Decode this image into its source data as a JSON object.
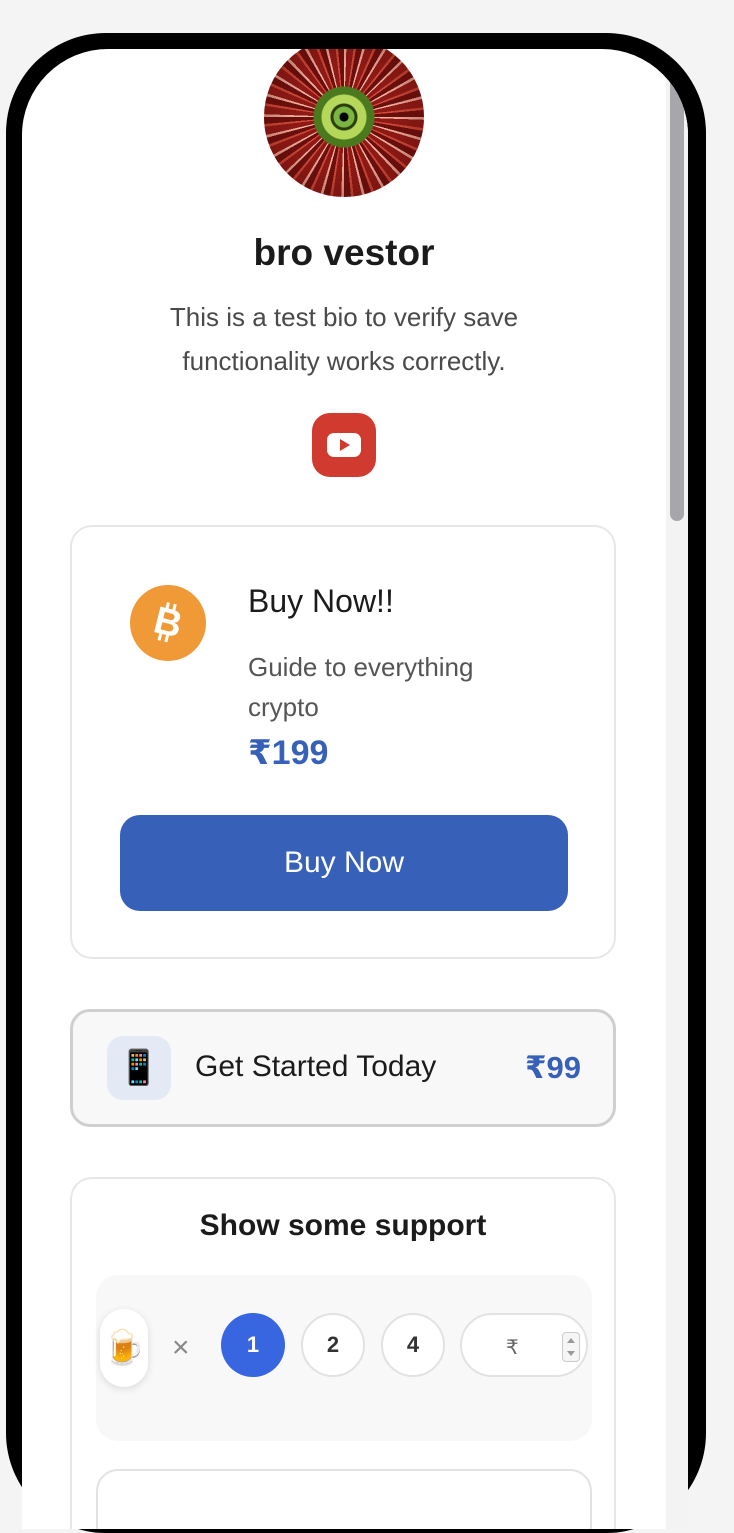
{
  "profile": {
    "name": "bro vestor",
    "bio": "This is a test bio to verify save functionality works correctly.",
    "social_icons": [
      "youtube-icon"
    ]
  },
  "product_card": {
    "icon": "bitcoin-icon",
    "title": "Buy Now!!",
    "description": "Guide to everything crypto",
    "price": "₹199",
    "button_label": "Buy Now"
  },
  "link_card": {
    "icon": "mobile-phone-icon",
    "icon_glyph": "📱",
    "title": "Get Started Today",
    "price": "₹99"
  },
  "support": {
    "title": "Show some support",
    "item_icon": "beer-mug-icon",
    "item_glyph": "🍺",
    "multiplier": "×",
    "quantities": [
      "1",
      "2",
      "4"
    ],
    "selected_quantity": "1",
    "custom_amount_symbol": "₹"
  },
  "colors": {
    "accent": "#3761b8",
    "selected": "#3866e0",
    "youtube": "#d13a2e",
    "bitcoin": "#ef9a37"
  }
}
